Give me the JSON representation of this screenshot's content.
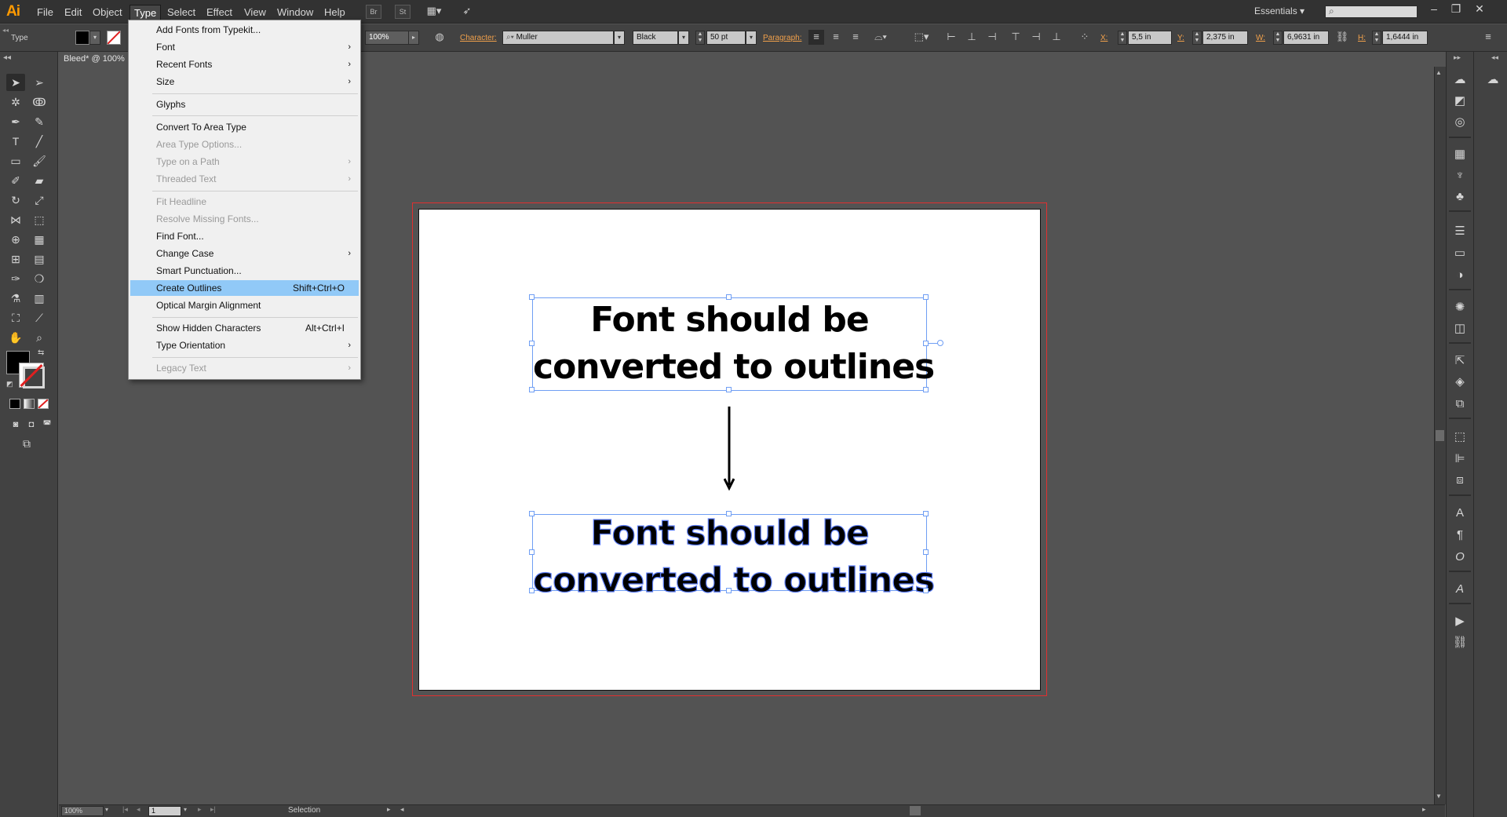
{
  "app": {
    "logo": "Ai"
  },
  "menubar": {
    "items": [
      "File",
      "Edit",
      "Object",
      "Type",
      "Select",
      "Effect",
      "View",
      "Window",
      "Help"
    ],
    "active": "Type",
    "buttons": [
      "Br",
      "St"
    ],
    "workspace": "Essentials",
    "window_controls": [
      "–",
      "❐",
      "✕"
    ]
  },
  "controlbar": {
    "tool_label": "Type",
    "opacity": "100%",
    "character_label": "Character:",
    "font_family": "Muller",
    "font_style": "Black",
    "font_size": "50 pt",
    "paragraph_label": "Paragraph:",
    "x_label": "X:",
    "x_value": "5,5 in",
    "y_label": "Y:",
    "y_value": "2,375 in",
    "w_label": "W:",
    "w_value": "6,9631 in",
    "h_label": "H:",
    "h_value": "1,6444 in"
  },
  "document": {
    "tab_title": "Bleed* @ 100%"
  },
  "artboard": {
    "headline_line1": "Font should be",
    "headline_line2": "converted to outlines",
    "outlined_line1": "Font should be",
    "outlined_line2": "converted to outlines"
  },
  "type_menu": {
    "items": [
      {
        "label": "Add Fonts from Typekit...",
        "shortcut": "",
        "submenu": false,
        "disabled": false
      },
      {
        "label": "Font",
        "shortcut": "",
        "submenu": true,
        "disabled": false
      },
      {
        "label": "Recent Fonts",
        "shortcut": "",
        "submenu": true,
        "disabled": false
      },
      {
        "label": "Size",
        "shortcut": "",
        "submenu": true,
        "disabled": false
      },
      {
        "label": "Glyphs",
        "shortcut": "",
        "submenu": false,
        "disabled": false
      },
      {
        "label": "Convert To Area Type",
        "shortcut": "",
        "submenu": false,
        "disabled": false
      },
      {
        "label": "Area Type Options...",
        "shortcut": "",
        "submenu": false,
        "disabled": true
      },
      {
        "label": "Type on a Path",
        "shortcut": "",
        "submenu": true,
        "disabled": true
      },
      {
        "label": "Threaded Text",
        "shortcut": "",
        "submenu": true,
        "disabled": true
      },
      {
        "label": "Fit Headline",
        "shortcut": "",
        "submenu": false,
        "disabled": true
      },
      {
        "label": "Resolve Missing Fonts...",
        "shortcut": "",
        "submenu": false,
        "disabled": true
      },
      {
        "label": "Find Font...",
        "shortcut": "",
        "submenu": false,
        "disabled": false
      },
      {
        "label": "Change Case",
        "shortcut": "",
        "submenu": true,
        "disabled": false
      },
      {
        "label": "Smart Punctuation...",
        "shortcut": "",
        "submenu": false,
        "disabled": false
      },
      {
        "label": "Create Outlines",
        "shortcut": "Shift+Ctrl+O",
        "submenu": false,
        "disabled": false,
        "highlighted": true
      },
      {
        "label": "Optical Margin Alignment",
        "shortcut": "",
        "submenu": false,
        "disabled": false
      },
      {
        "label": "Show Hidden Characters",
        "shortcut": "Alt+Ctrl+I",
        "submenu": false,
        "disabled": false
      },
      {
        "label": "Type Orientation",
        "shortcut": "",
        "submenu": true,
        "disabled": false
      },
      {
        "label": "Legacy Text",
        "shortcut": "",
        "submenu": true,
        "disabled": true
      }
    ]
  },
  "statusbar": {
    "zoom": "100%",
    "artboard_number": "1",
    "current_tool": "Selection"
  },
  "colors": {
    "accent_orange": "#ff9a00",
    "selection_blue": "#6f9ef4",
    "menu_highlight": "#91c9f7",
    "bleed_red": "#e03030"
  }
}
